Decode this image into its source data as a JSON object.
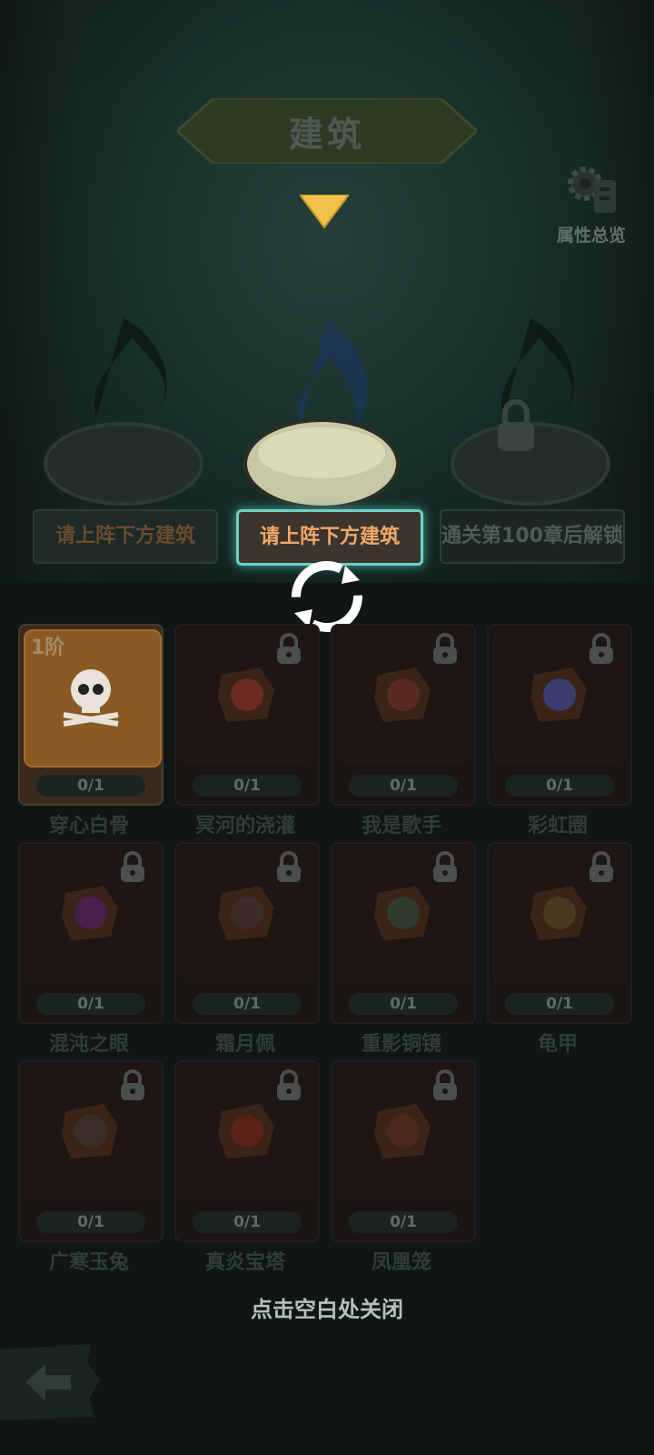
{
  "title": "建筑",
  "attr_button": {
    "label": "属性总览",
    "icon": "gear-icon"
  },
  "slots": [
    {
      "label": "请上阵下方建筑",
      "state": "dim"
    },
    {
      "label": "请上阵下方建筑",
      "state": "active"
    },
    {
      "label": "通关第100章后解锁",
      "state": "locked"
    }
  ],
  "cards": [
    {
      "name": "穿心白骨",
      "count": "0/1",
      "tier": "1阶",
      "active": true,
      "icon": "skull-icon",
      "color": "#e8e2d8"
    },
    {
      "name": "冥河的浇灌",
      "count": "0/1",
      "active": false,
      "icon": "watering-can-icon",
      "color": "#6b2a22"
    },
    {
      "name": "我是歌手",
      "count": "0/1",
      "active": false,
      "icon": "microphone-icon",
      "color": "#5a2a20"
    },
    {
      "name": "彩虹圈",
      "count": "0/1",
      "active": false,
      "icon": "rainbow-spring-icon",
      "color": "#3a3b6e"
    },
    {
      "name": "混沌之眼",
      "count": "0/1",
      "active": false,
      "icon": "eye-orb-icon",
      "color": "#4a1f4a"
    },
    {
      "name": "霜月佩",
      "count": "0/1",
      "active": false,
      "icon": "moon-pendant-icon",
      "color": "#3e2a26"
    },
    {
      "name": "重影铜镜",
      "count": "0/1",
      "active": false,
      "icon": "mirror-icon",
      "color": "#2f3b2f"
    },
    {
      "name": "龟甲",
      "count": "0/1",
      "active": false,
      "icon": "turtle-shell-icon",
      "color": "#4a3820"
    },
    {
      "name": "广寒玉兔",
      "count": "0/1",
      "active": false,
      "icon": "rabbit-icon",
      "color": "#3b2e2a"
    },
    {
      "name": "真炎宝塔",
      "count": "0/1",
      "active": false,
      "icon": "pagoda-icon",
      "color": "#5a2218"
    },
    {
      "name": "凤凰笼",
      "count": "0/1",
      "active": false,
      "icon": "cage-icon",
      "color": "#4a2a1a"
    }
  ],
  "close_hint": "点击空白处关闭",
  "colors": {
    "accent": "#f0c24a",
    "active_card": "#8a5a24"
  }
}
